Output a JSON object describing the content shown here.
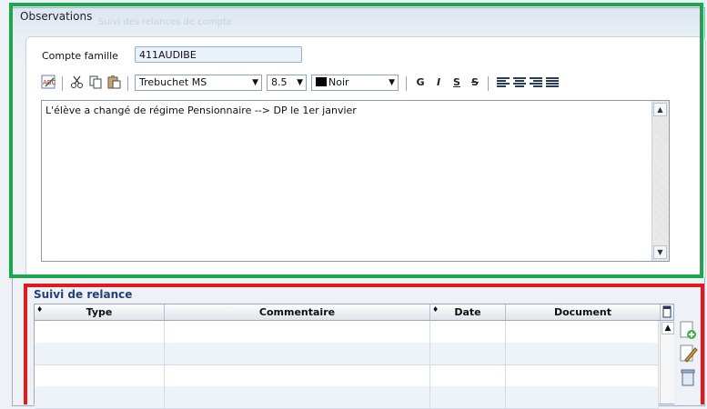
{
  "window": {
    "title": "Observations",
    "ghost_title": "Suivi des relances de compte"
  },
  "form": {
    "compte_label": "Compte famille",
    "compte_value": "411AUDIBE"
  },
  "toolbar": {
    "font_name": "Trebuchet MS",
    "font_size": "8.5",
    "color_label": "Noir",
    "bold": "G",
    "italic": "I",
    "underline": "S",
    "strike": "S",
    "icons": [
      "spellcheck-icon",
      "cut-icon",
      "copy-icon",
      "paste-icon",
      "align-left-icon",
      "align-center-icon",
      "align-right-icon",
      "justify-icon"
    ]
  },
  "editor": {
    "text": "L'élève a changé de régime Pensionnaire --> DP le 1er janvier"
  },
  "relance": {
    "title": "Suivi de relance",
    "columns": [
      "Type",
      "Commentaire",
      "Date",
      "Document"
    ],
    "rows": [
      [
        "",
        "",
        "",
        ""
      ],
      [
        "",
        "",
        "",
        ""
      ],
      [
        "",
        "",
        "",
        ""
      ],
      [
        "",
        "",
        "",
        ""
      ]
    ]
  },
  "colors": {
    "highlight_green": "#1aa84a",
    "highlight_red": "#e3191c",
    "section_title": "#21407a"
  }
}
